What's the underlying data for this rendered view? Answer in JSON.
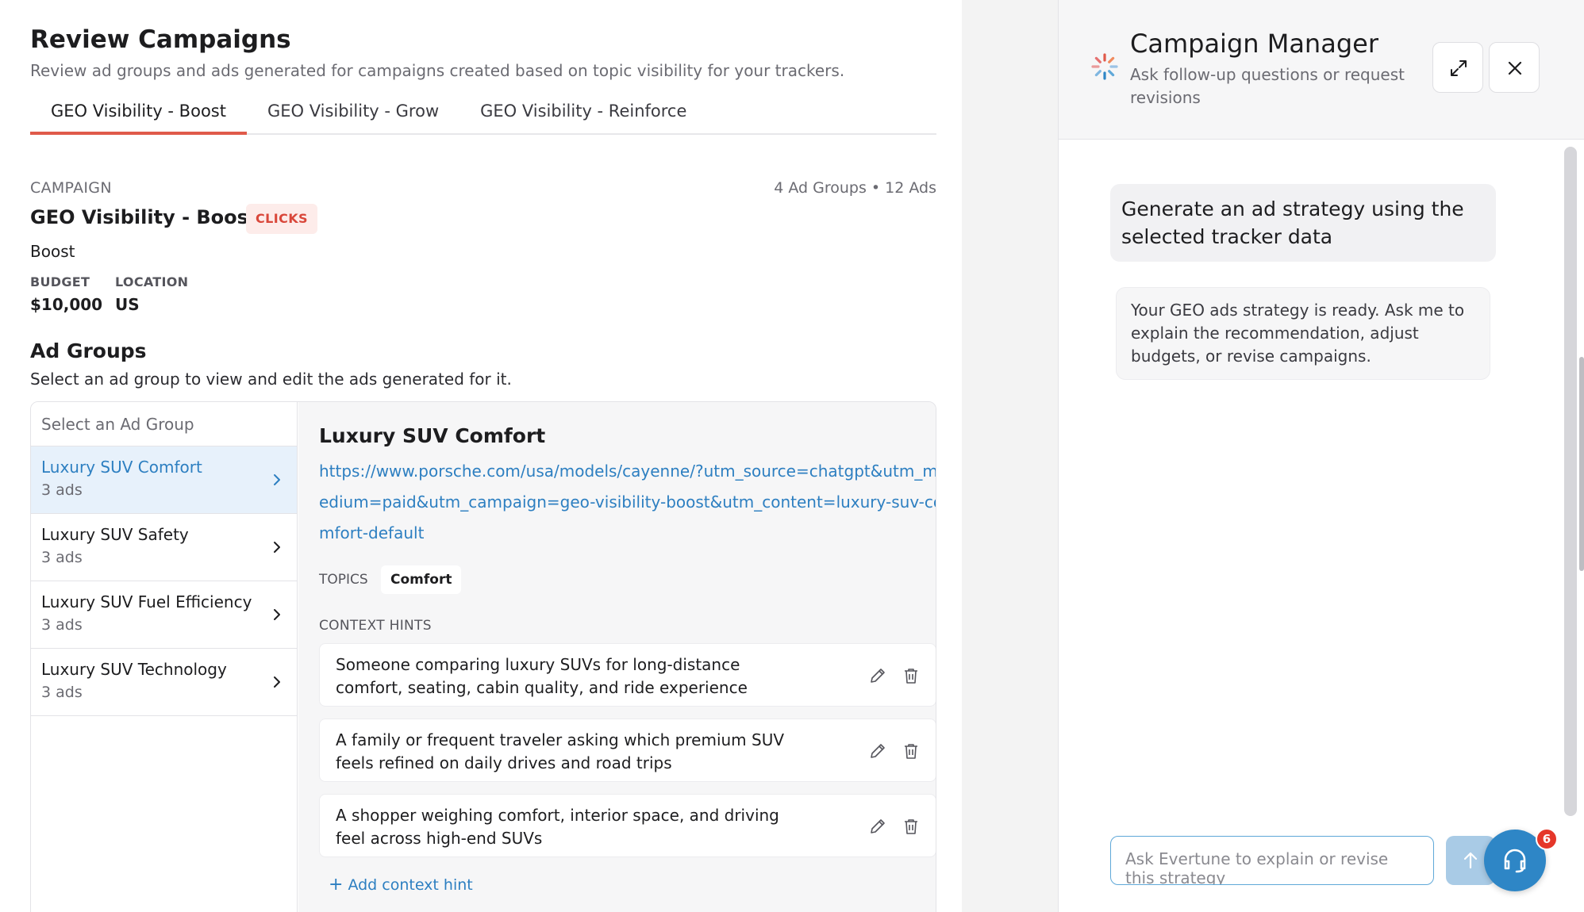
{
  "header": {
    "title": "Review Campaigns",
    "subtitle": "Review ad groups and ads generated for campaigns created based on topic visibility for your trackers."
  },
  "tabs": [
    {
      "label": "GEO Visibility - Boost",
      "active": true
    },
    {
      "label": "GEO Visibility - Grow",
      "active": false
    },
    {
      "label": "GEO Visibility - Reinforce",
      "active": false
    }
  ],
  "campaign": {
    "section_label": "CAMPAIGN",
    "summary": "4 Ad Groups • 12 Ads",
    "name": "GEO Visibility - Boost",
    "badge": "CLICKS",
    "type": "Boost",
    "budget_label": "BUDGET",
    "budget_value": "$10,000",
    "location_label": "LOCATION",
    "location_value": "US"
  },
  "ad_groups": {
    "title": "Ad Groups",
    "subtitle": "Select an ad group to view and edit the ads generated for it.",
    "list_header": "Select an Ad Group",
    "items": [
      {
        "name": "Luxury SUV Comfort",
        "count": "3 ads",
        "active": true
      },
      {
        "name": "Luxury SUV Safety",
        "count": "3 ads",
        "active": false
      },
      {
        "name": "Luxury SUV Fuel Efficiency",
        "count": "3 ads",
        "active": false
      },
      {
        "name": "Luxury SUV Technology",
        "count": "3 ads",
        "active": false
      }
    ]
  },
  "detail": {
    "title": "Luxury SUV Comfort",
    "url": "https://www.porsche.com/usa/models/cayenne/?utm_source=chatgpt&utm_medium=paid&utm_campaign=geo-visibility-boost&utm_content=luxury-suv-comfort-default",
    "topics_label": "TOPICS",
    "topic": "Comfort",
    "hints_label": "CONTEXT HINTS",
    "hints": [
      "Someone comparing luxury SUVs for long-distance comfort, seating, cabin quality, and ride experience",
      "A family or frequent traveler asking which premium SUV feels refined on daily drives and road trips",
      "A shopper weighing comfort, interior space, and driving feel across high-end SUVs"
    ],
    "add_hint": "Add context hint"
  },
  "chat": {
    "title": "Campaign Manager",
    "subtitle": "Ask follow-up questions or request revisions",
    "user_message": "Generate an ad strategy using the selected tracker data",
    "bot_message": "Your GEO ads strategy is ready. Ask me to explain the recommendation, adjust budgets, or revise campaigns.",
    "input_placeholder": "Ask Evertune to explain or revise this strategy",
    "help_badge_count": "6"
  },
  "colors": {
    "accent": "#e05a4a",
    "link": "#2d7fc1",
    "active_bg": "#e7f1fb",
    "badge_bg": "#fdecea",
    "help_button": "#2e86c6"
  },
  "icons": [
    "chevron-right-icon",
    "edit-icon",
    "trash-icon",
    "plus-icon",
    "spinner-icon",
    "expand-icon",
    "close-icon",
    "arrow-up-icon",
    "headset-icon"
  ]
}
